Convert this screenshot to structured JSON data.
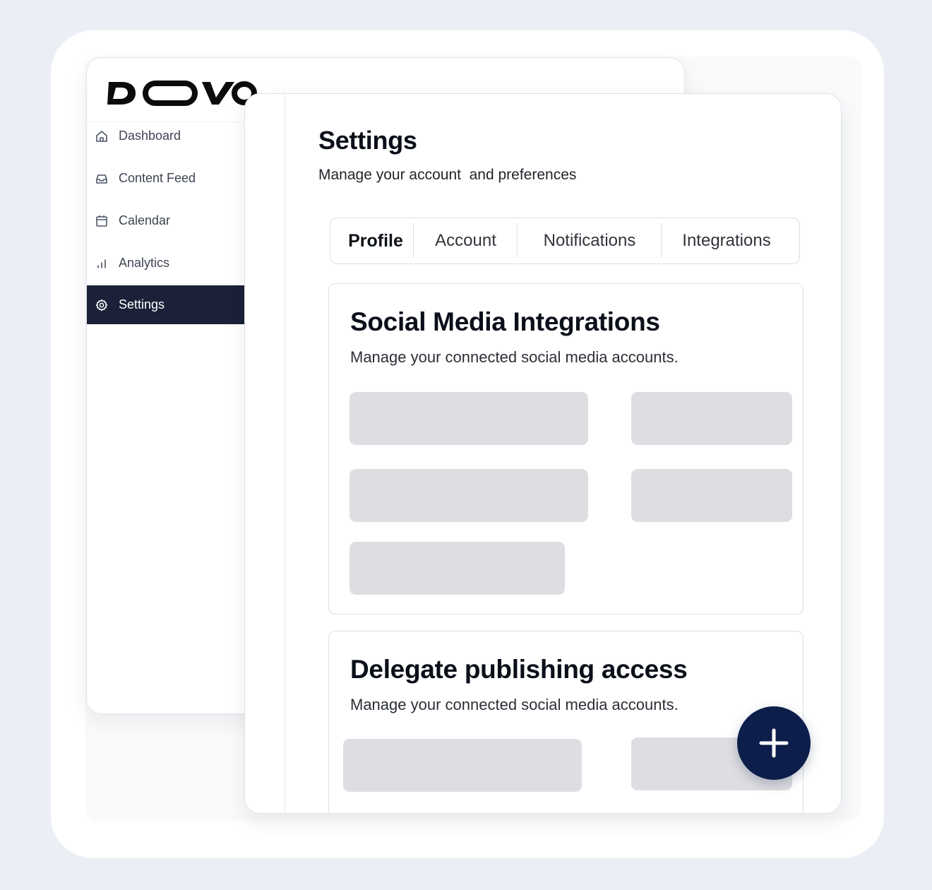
{
  "brand": {
    "logo_text": "DOVO"
  },
  "sidebar": {
    "items": [
      {
        "label": "Dashboard",
        "icon": "home-icon",
        "active": false
      },
      {
        "label": "Content Feed",
        "icon": "inbox-icon",
        "active": false
      },
      {
        "label": "Calendar",
        "icon": "calendar-icon",
        "active": false
      },
      {
        "label": "Analytics",
        "icon": "bar-chart-icon",
        "active": false
      },
      {
        "label": "Settings",
        "icon": "gear-icon",
        "active": true
      }
    ]
  },
  "page": {
    "title": "Settings",
    "subtitle": "Manage your account  and preferences"
  },
  "tabs": [
    {
      "label": "Profile",
      "active": true
    },
    {
      "label": "Account",
      "active": false
    },
    {
      "label": "Notifications",
      "active": false
    },
    {
      "label": "Integrations",
      "active": false
    }
  ],
  "cards": {
    "social": {
      "title": "Social Media Integrations",
      "description": "Manage your connected social media accounts."
    },
    "delegate": {
      "title": "Delegate publishing access",
      "description": "Manage your connected social media accounts."
    }
  },
  "fab": {
    "icon": "plus-icon"
  },
  "colors": {
    "background": "#ebeff5",
    "sidebar_active": "#1a2138",
    "fab": "#0d1e4a",
    "skeleton": "#dedee2"
  }
}
